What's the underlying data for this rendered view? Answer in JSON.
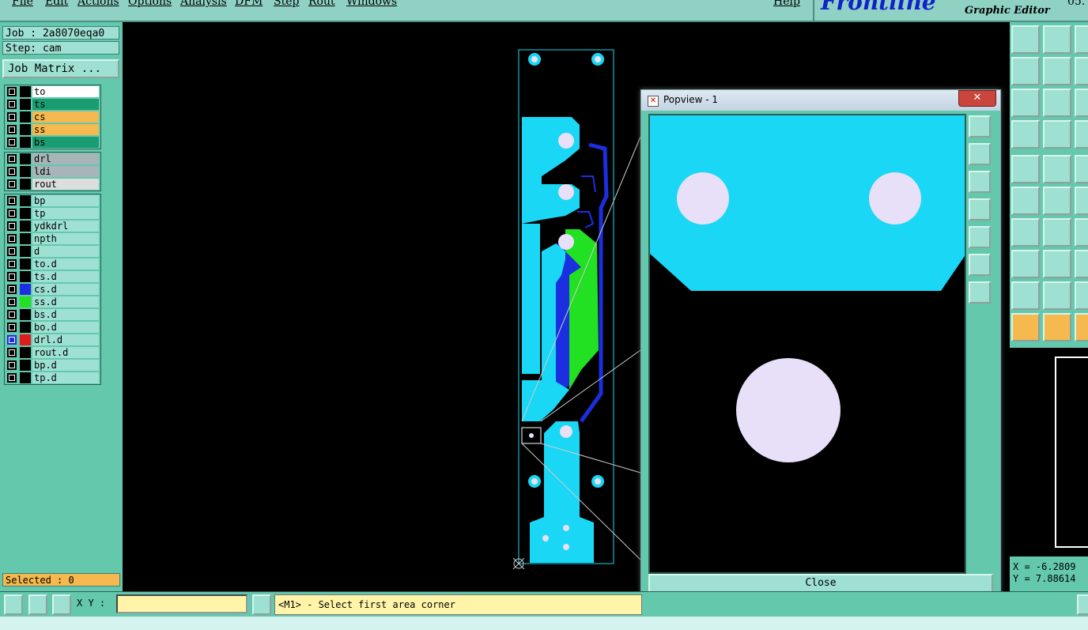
{
  "menu": {
    "items": [
      "File",
      "Edit",
      "Actions",
      "Options",
      "Analysis",
      "DFM",
      "Step",
      "Rout",
      "Windows"
    ],
    "help": "Help"
  },
  "brand": {
    "logo": "Frontline",
    "subtitle": "Graphic Editor",
    "version": "05."
  },
  "job": {
    "job_line": "Job : 2a8070eqa0",
    "step_line": "Step: cam",
    "matrix_button": "Job Matrix ..."
  },
  "layers": {
    "group1": [
      {
        "name": "to",
        "color": "#ffffff"
      },
      {
        "name": "ts",
        "color": "#1a9c72"
      },
      {
        "name": "cs",
        "color": "#f5b94f"
      },
      {
        "name": "ss",
        "color": "#f5b94f"
      },
      {
        "name": "bs",
        "color": "#1a9c72"
      }
    ],
    "group2": [
      {
        "name": "drl",
        "color": "#a7b4b8"
      },
      {
        "name": "ldi",
        "color": "#a7b4b8"
      },
      {
        "name": "rout",
        "color": "#dddddd"
      }
    ],
    "group3": [
      {
        "name": "bp",
        "color": "#9ee0d2"
      },
      {
        "name": "tp",
        "color": "#9ee0d2"
      },
      {
        "name": "ydkdrl",
        "color": "#9ee0d2"
      },
      {
        "name": "npth",
        "color": "#9ee0d2"
      },
      {
        "name": "d",
        "color": "#9ee0d2"
      },
      {
        "name": "to.d",
        "color": "#9ee0d2"
      },
      {
        "name": "ts.d",
        "color": "#9ee0d2"
      },
      {
        "name": "cs.d",
        "color": "#9ee0d2",
        "swatch": "#1b2fe0"
      },
      {
        "name": "ss.d",
        "color": "#9ee0d2",
        "swatch": "#22e022"
      },
      {
        "name": "bs.d",
        "color": "#9ee0d2"
      },
      {
        "name": "bo.d",
        "color": "#9ee0d2"
      },
      {
        "name": "drl.d",
        "color": "#9ee0d2",
        "swatch": "#e01b1b",
        "active": true
      },
      {
        "name": "rout.d",
        "color": "#9ee0d2"
      },
      {
        "name": "bp.d",
        "color": "#9ee0d2"
      },
      {
        "name": "tp.d",
        "color": "#9ee0d2"
      }
    ]
  },
  "selected": "Selected : 0",
  "popview": {
    "title": "Popview - 1",
    "close_label": "Close"
  },
  "coords": {
    "x": "X = -6.2809",
    "y": "Y = 7.88614"
  },
  "bottom": {
    "xy_label": "X Y :",
    "xy_value": "",
    "message": "<M1> - Select first area corner"
  },
  "colors": {
    "pad": "#19d7f5",
    "drill": "#e8e0f8",
    "trace_blue": "#1b2fe0",
    "trace_green": "#22e022",
    "panel": "#64c8ad"
  }
}
